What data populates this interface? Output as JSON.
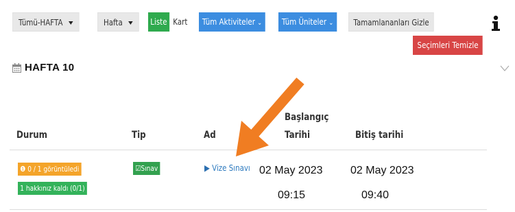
{
  "toolbar": {
    "week_filter": "Tümü-HAFTA",
    "week_select": "Hafta",
    "list_view": "Liste",
    "card_view": "Kart",
    "activities": "Tüm Aktiviteler",
    "units": "Tüm Üniteler",
    "hide_completed": "Tamamlananları Gizle",
    "clear_selection": "Seçimleri Temizle"
  },
  "section": {
    "title": "HAFTA 10"
  },
  "table": {
    "headers": {
      "status": "Durum",
      "type": "Tip",
      "name": "Ad",
      "start_line1": "Başlangıç",
      "start_line2": "Tarihi",
      "end": "Bitiş tarihi"
    },
    "rows": [
      {
        "status_views": "0 / 1 görüntüledi",
        "status_attempts": "1 hakkınız kaldı (0/1)",
        "type": "Sınav",
        "name": "Vize Sınavı",
        "start_date": "02 May 2023",
        "start_time": "09:15",
        "end_date": "02 May 2023",
        "end_time": "09:40"
      }
    ]
  },
  "colors": {
    "primary_blue": "#3c8de0",
    "green": "#2faa4e",
    "orange_badge": "#f4a42a",
    "danger_red": "#d84545",
    "annotation_arrow": "#f07d22"
  },
  "icons": [
    "caret-down-icon",
    "chevron-down-icon",
    "info-icon",
    "calendar-icon",
    "check-square-icon",
    "play-icon",
    "collapse-chevron-icon",
    "orange-arrow-annotation"
  ]
}
